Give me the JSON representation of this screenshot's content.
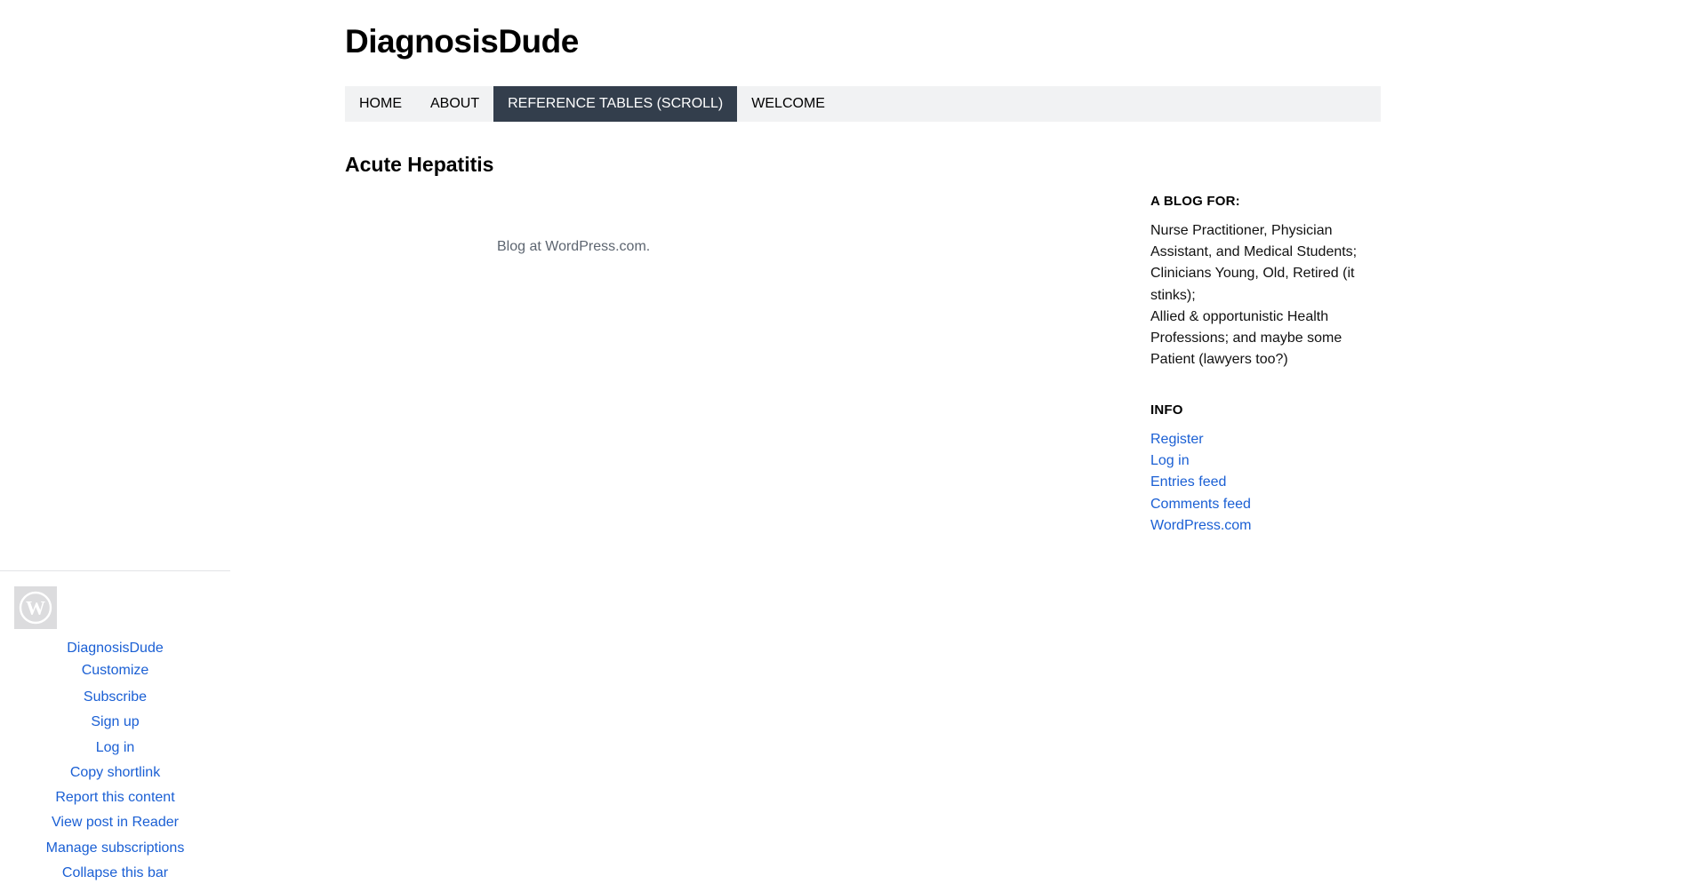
{
  "site": {
    "title": "DiagnosisDude"
  },
  "nav": {
    "items": [
      {
        "label": "HOME"
      },
      {
        "label": "ABOUT"
      },
      {
        "label": "REFERENCE TABLES (SCROLL)"
      },
      {
        "label": "WELCOME"
      }
    ],
    "active": "REFERENCE TABLES (SCROLL)"
  },
  "post": {
    "title": "Acute Hepatitis"
  },
  "footer": {
    "credit": "Blog at WordPress.com."
  },
  "sidebar": {
    "blog_for": {
      "title": "A BLOG FOR:",
      "lines": [
        "Nurse Practitioner, Physician",
        "Assistant, and Medical Students;",
        "Clinicians Young, Old, Retired (it",
        "stinks);",
        "Allied & opportunistic Health",
        "Professions; and maybe some",
        "Patient (lawyers too?)"
      ]
    },
    "info": {
      "title": "INFO",
      "links": [
        "Register",
        "Log in",
        "Entries feed",
        "Comments feed",
        "WordPress.com"
      ]
    }
  },
  "wpbar": {
    "site_name": "DiagnosisDude",
    "customize": "Customize",
    "actions": [
      "Subscribe",
      "Sign up",
      "Log in",
      "Copy shortlink",
      "Report this content",
      "View post in Reader",
      "Manage subscriptions",
      "Collapse this bar"
    ]
  },
  "colors": {
    "link": "#1a5fd4",
    "nav_active_bg": "#333e4c",
    "nav_bg": "#f1f2f3",
    "credit": "#5d6570"
  }
}
